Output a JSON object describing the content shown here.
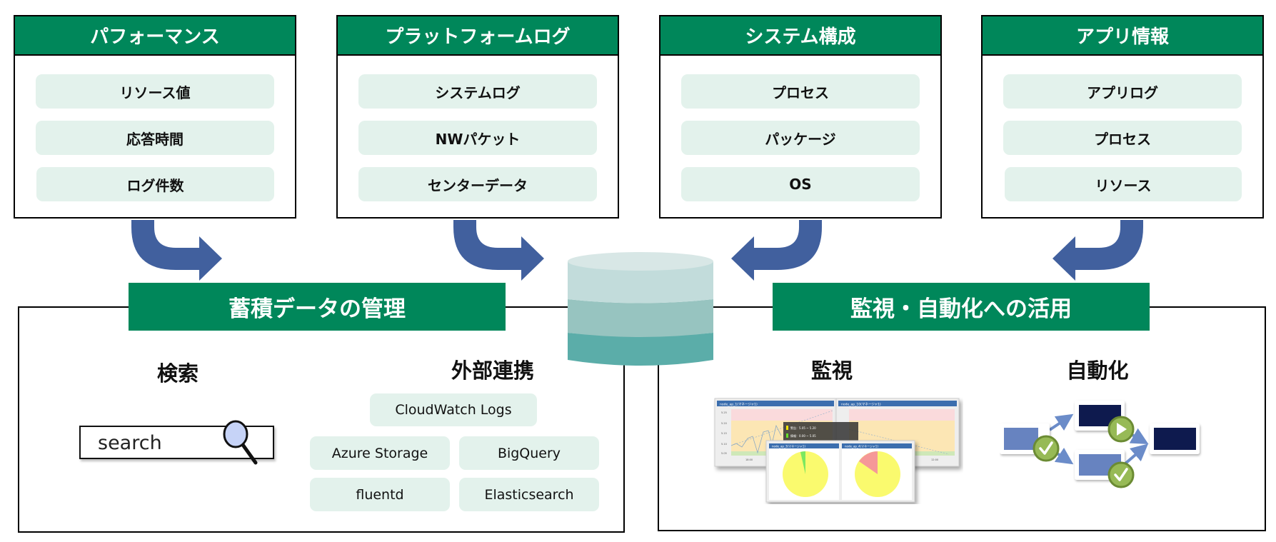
{
  "top_boxes": [
    {
      "title": "パフォーマンス",
      "items": [
        "リソース値",
        "応答時間",
        "ログ件数"
      ]
    },
    {
      "title": "プラットフォームログ",
      "items": [
        "システムログ",
        "NWパケット",
        "センターデータ"
      ]
    },
    {
      "title": "システム構成",
      "items": [
        "プロセス",
        "パッケージ",
        "OS"
      ]
    },
    {
      "title": "アプリ情報",
      "items": [
        "アプリログ",
        "プロセス",
        "リソース"
      ]
    }
  ],
  "storage": {
    "title": "蓄積データの管理",
    "search": {
      "label": "検索",
      "value": "search",
      "icon": "magnifier-icon"
    },
    "integration": {
      "label": "外部連携",
      "targets": [
        "CloudWatch Logs",
        "Azure Storage",
        "BigQuery",
        "fluentd",
        "Elasticsearch"
      ]
    }
  },
  "usage": {
    "title": "監視・自動化への活用",
    "monitoring": {
      "label": "監視",
      "panels": [
        "node_ap_1(マネージャ1)",
        "node_ap_10(マネージャ1)",
        "node_ap_3(マネージャ1)",
        "node_ap_4(マネージャ1)"
      ],
      "legend": [
        "警告：5.05 ~ 5.20",
        "情報：0.00 ~ 5.05"
      ],
      "y_ticks": [
        "5.25",
        "5.20",
        "5.15",
        "5.10",
        "5.05"
      ],
      "x_ticks": [
        "18:00",
        "12:00"
      ]
    },
    "automation": {
      "label": "自動化",
      "icons": [
        "check-icon",
        "play-icon",
        "check-icon"
      ]
    }
  },
  "colors": {
    "header_green": "#00875A",
    "pill": "#E3F2EC",
    "arrow": "#41609E",
    "db_top": "#D8E7E6",
    "db_band1": "#C2DCDB",
    "db_band2": "#97C4C0",
    "db_band3": "#5BADA9"
  }
}
